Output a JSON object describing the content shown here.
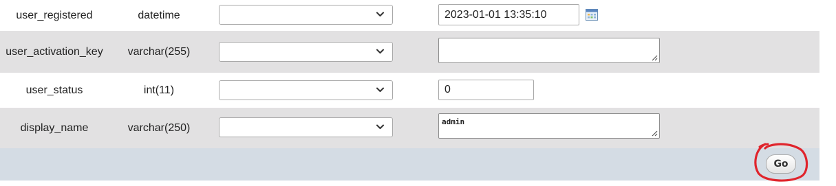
{
  "rows": [
    {
      "name": "user_registered",
      "type": "datetime",
      "function_value": "",
      "value": "2023-01-01 13:35:10",
      "value_kind": "datetime"
    },
    {
      "name": "user_activation_key",
      "type": "varchar(255)",
      "function_value": "",
      "value": "",
      "value_kind": "textarea"
    },
    {
      "name": "user_status",
      "type": "int(11)",
      "function_value": "",
      "value": "0",
      "value_kind": "input"
    },
    {
      "name": "display_name",
      "type": "varchar(250)",
      "function_value": "",
      "value": "admin",
      "value_kind": "textarea"
    }
  ],
  "footer": {
    "go_label": "Go"
  },
  "icons": {
    "select_arrow": "chevron-down-icon",
    "date_picker": "calendar-icon",
    "resize": "resize-grip-icon"
  },
  "colors": {
    "row_alt": "#e2e1e2",
    "footer_bg": "#d4dce4",
    "annotation": "#e0242c"
  }
}
